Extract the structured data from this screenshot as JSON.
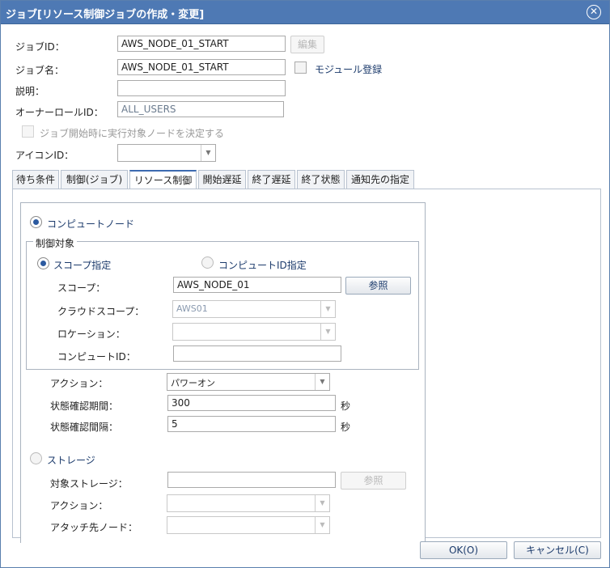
{
  "window": {
    "title": "ジョブ[リソース制御ジョブの作成・変更]"
  },
  "form": {
    "job_id_label": "ジョブID：",
    "job_id_value": "AWS_NODE_01_START",
    "edit_button": "編集",
    "job_name_label": "ジョブ名：",
    "job_name_value": "AWS_NODE_01_START",
    "module_label": "モジュール登録",
    "description_label": "説明：",
    "description_value": "",
    "owner_label": "オーナーロールID：",
    "owner_value": "ALL_USERS",
    "decide_node_label": "ジョブ開始時に実行対象ノードを決定する",
    "icon_label": "アイコンID：",
    "icon_value": ""
  },
  "tabs": [
    {
      "label": "待ち条件"
    },
    {
      "label": "制御(ジョブ)"
    },
    {
      "label": "リソース制御"
    },
    {
      "label": "開始遅延"
    },
    {
      "label": "終了遅延"
    },
    {
      "label": "終了状態"
    },
    {
      "label": "通知先の指定"
    }
  ],
  "resource": {
    "compute_label": "コンピュートノード",
    "target_group_label": "制御対象",
    "scope_radio_label": "スコープ指定",
    "compute_id_radio_label": "コンピュートID指定",
    "scope_label": "スコープ：",
    "scope_value": "AWS_NODE_01",
    "browse_button": "参照",
    "cloud_scope_label": "クラウドスコープ：",
    "cloud_scope_value": "AWS01",
    "location_label": "ロケーション：",
    "location_value": "",
    "compute_id_label": "コンピュートID：",
    "compute_id_value": "",
    "action_label": "アクション：",
    "action_value": "パワーオン",
    "check_period_label": "状態確認期間：",
    "check_period_value": "300",
    "check_interval_label": "状態確認間隔：",
    "check_interval_value": "5",
    "sec_unit": "秒",
    "storage_label": "ストレージ",
    "target_storage_label": "対象ストレージ：",
    "target_storage_value": "",
    "storage_browse_button": "参照",
    "storage_action_label": "アクション：",
    "storage_action_value": "",
    "attach_node_label": "アタッチ先ノード：",
    "attach_node_value": ""
  },
  "footer": {
    "ok_button": "OK(O)",
    "cancel_button": "キャンセル(C)"
  }
}
